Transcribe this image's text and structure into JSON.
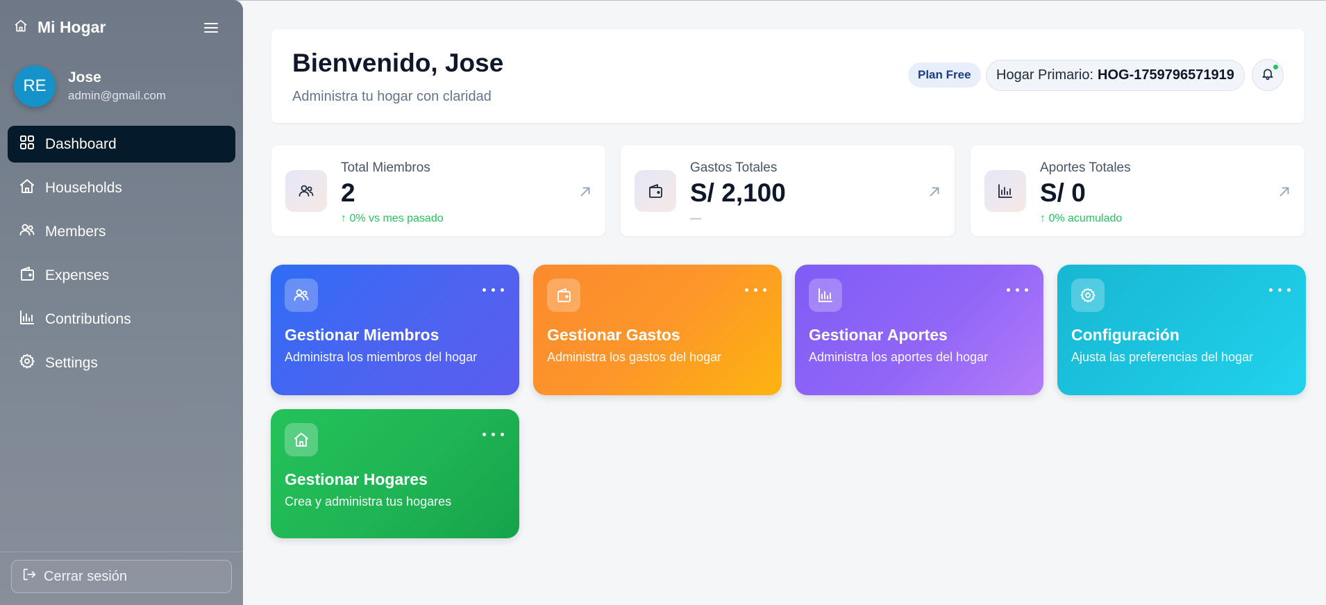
{
  "sidebar": {
    "brand": "Mi Hogar",
    "user": {
      "initials": "RE",
      "name": "Jose",
      "email": "admin@gmail.com"
    },
    "items": [
      {
        "label": "Dashboard",
        "icon": "grid-icon",
        "active": true
      },
      {
        "label": "Households",
        "icon": "home-icon",
        "active": false
      },
      {
        "label": "Members",
        "icon": "users-icon",
        "active": false
      },
      {
        "label": "Expenses",
        "icon": "wallet-icon",
        "active": false
      },
      {
        "label": "Contributions",
        "icon": "bar-chart-icon",
        "active": false
      },
      {
        "label": "Settings",
        "icon": "gear-icon",
        "active": false
      }
    ],
    "logout_label": "Cerrar sesión"
  },
  "header": {
    "title": "Bienvenido, Jose",
    "subtitle": "Administra tu hogar con claridad",
    "plan_badge": "Plan Free",
    "hogar_label": "Hogar Primario:",
    "hogar_code": "HOG-1759796571919",
    "notification_status_color": "#22c55e"
  },
  "stats": [
    {
      "label": "Total Miembros",
      "value": "2",
      "sub": "↑ 0% vs mes pasado",
      "icon": "users-icon"
    },
    {
      "label": "Gastos Totales",
      "value": "S/ 2,100",
      "sub": "—",
      "icon": "wallet-icon"
    },
    {
      "label": "Aportes Totales",
      "value": "S/ 0",
      "sub": "↑ 0% acumulado",
      "icon": "bar-chart-icon"
    }
  ],
  "actions": [
    {
      "title": "Gestionar Miembros",
      "desc": "Administra los miembros del hogar",
      "icon": "users-icon",
      "color": "#3b66f5"
    },
    {
      "title": "Gestionar Gastos",
      "desc": "Administra los gastos del hogar",
      "icon": "wallet-icon",
      "color": "#fd962a"
    },
    {
      "title": "Gestionar Aportes",
      "desc": "Administra los aportes del hogar",
      "icon": "bar-chart-icon",
      "color": "#9166f7"
    },
    {
      "title": "Configuración",
      "desc": "Ajusta las preferencias del hogar",
      "icon": "gear-icon",
      "color": "#1cc5e0"
    },
    {
      "title": "Gestionar Hogares",
      "desc": "Crea y administra tus hogares",
      "icon": "home-icon",
      "color": "#1fb454"
    }
  ],
  "colors": {
    "sidebar_active": "#051b2c",
    "accent_positive": "#22c55e",
    "avatar": "#1592c9"
  }
}
